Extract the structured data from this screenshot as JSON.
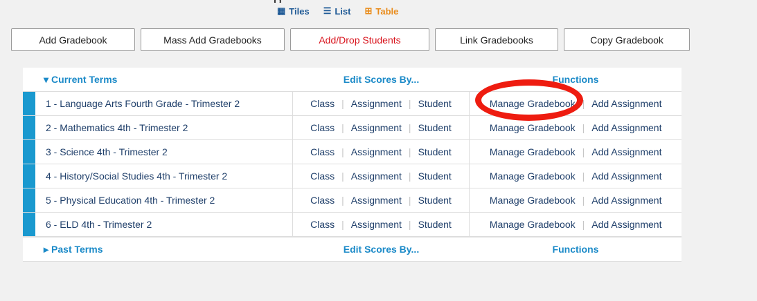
{
  "page": {
    "heading_partial": "g"
  },
  "view_switch": [
    {
      "icon": "grid-icon",
      "label": "Tiles",
      "active": false
    },
    {
      "icon": "list-icon",
      "label": "List",
      "active": false
    },
    {
      "icon": "table-icon",
      "label": "Table",
      "active": true
    }
  ],
  "toolbar": {
    "add_gradebook": "Add Gradebook",
    "mass_add": "Mass Add Gradebooks",
    "add_drop": "Add/Drop Students",
    "link": "Link Gradebooks",
    "copy": "Copy Gradebook"
  },
  "table": {
    "current_header": "Current Terms",
    "edit_header": "Edit Scores By...",
    "functions_header": "Functions",
    "rows": [
      {
        "name": "1 - Language Arts Fourth Grade - Trimester 2"
      },
      {
        "name": "2 - Mathematics 4th - Trimester 2"
      },
      {
        "name": "3 - Science 4th - Trimester 2"
      },
      {
        "name": "4 - History/Social Studies 4th - Trimester 2"
      },
      {
        "name": "5 - Physical Education 4th - Trimester 2"
      },
      {
        "name": "6 - ELD 4th - Trimester 2"
      }
    ],
    "edit_options": {
      "class": "Class",
      "assignment": "Assignment",
      "student": "Student"
    },
    "functions": {
      "manage": "Manage Gradebook",
      "add_assignment": "Add Assignment"
    },
    "past_header": "Past Terms",
    "past_edit_header": "Edit Scores By...",
    "past_functions_header": "Functions"
  },
  "colors": {
    "accent_blue": "#1b8ac8",
    "row_stripe": "#1a99cf",
    "red_button_text": "#d8111a",
    "annotation_red": "#ee1c10",
    "active_view": "#e98b1a"
  }
}
